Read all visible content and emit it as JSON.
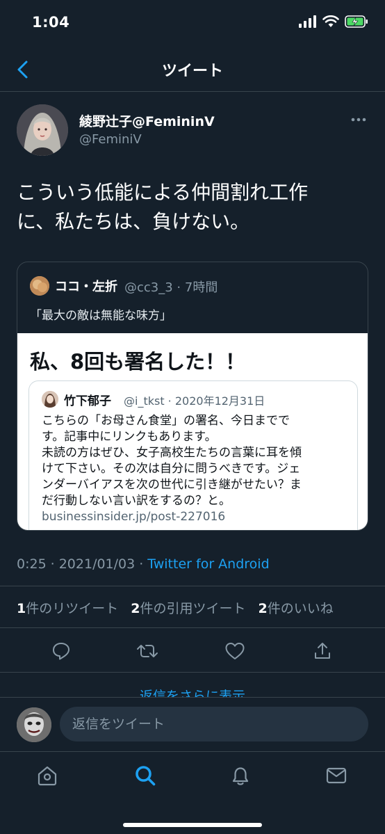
{
  "status_bar": {
    "time": "1:04"
  },
  "nav": {
    "title": "ツイート"
  },
  "tweet": {
    "display_name": "綾野辻子@FemininV",
    "handle": "@FeminiV",
    "text_line1": "こういう低能による仲間割れ工作",
    "text_line2": "に、私たちは、負けない。",
    "time": "0:25",
    "date": "2021/01/03",
    "client": "Twitter for Android",
    "separator": "·"
  },
  "quote": {
    "name": "ココ・左折",
    "meta": "@cc3_3 · 7時間",
    "text": "「最大の敵は無能な味方」",
    "image_title": "私、8回も署名した！！",
    "inner": {
      "name": "竹下郁子",
      "meta": "@i_tkst · 2020年12月31日",
      "lines": [
        "こちらの「お母さん食堂」の署名、今日までで",
        "す。記事中にリンクもあります。",
        "未読の方はぜひ、女子高校生たちの言葉に耳を傾",
        "けて下さい。その次は自分に問うべきです。ジェ",
        "ンダーバイアスを次の世代に引き継がせたい？ま",
        "だ行動しない言い訳をするの？と。",
        "businessinsider.jp/post-227016"
      ]
    }
  },
  "stats": {
    "retweets_count": "1",
    "retweets_label": "件のリツイート",
    "quotes_count": "2",
    "quotes_label": "件の引用ツイート",
    "likes_count": "2",
    "likes_label": "件のいいね"
  },
  "more_replies": "返信をさらに表示",
  "compose": {
    "placeholder": "返信をツイート"
  },
  "colors": {
    "background": "#15202b",
    "accent": "#1da1f2",
    "secondary_text": "#8899a6",
    "border": "#38444d"
  },
  "icons": [
    "chevron-left-icon",
    "more-icon",
    "reply-icon",
    "retweet-icon",
    "like-icon",
    "share-icon",
    "home-icon",
    "search-icon",
    "notifications-icon",
    "messages-icon"
  ]
}
